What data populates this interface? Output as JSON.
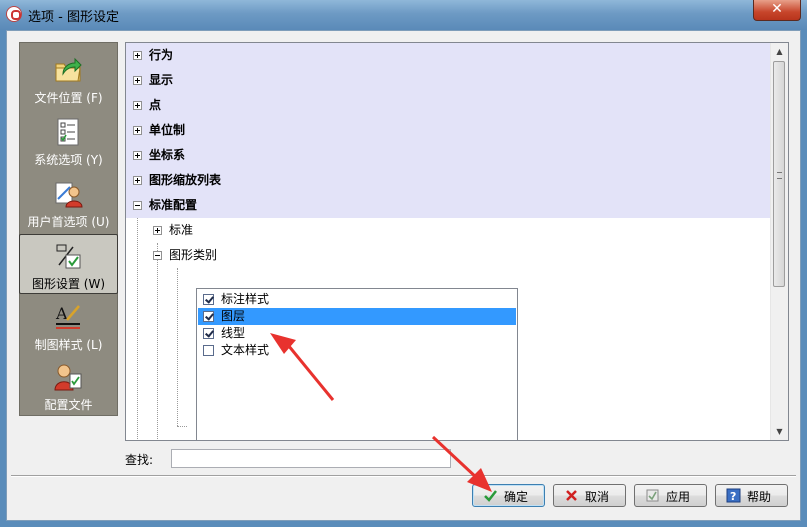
{
  "window": {
    "title": "选项 - 图形设定",
    "close_label": "✕"
  },
  "sidebar": {
    "items": [
      {
        "label": "文件位置 (F)",
        "icon": "folder-arrow-icon",
        "selected": false
      },
      {
        "label": "系统选项 (Y)",
        "icon": "checklist-icon",
        "selected": false
      },
      {
        "label": "用户首选项 (U)",
        "icon": "user-preferences-icon",
        "selected": false
      },
      {
        "label": "图形设置 (W)",
        "icon": "graphic-settings-icon",
        "selected": true
      },
      {
        "label": "制图样式 (L)",
        "icon": "drafting-style-icon",
        "selected": false
      },
      {
        "label": "配置文件",
        "icon": "profile-icon",
        "selected": false
      }
    ]
  },
  "tree": {
    "items": [
      {
        "label": "行为",
        "expanded": false
      },
      {
        "label": "显示",
        "expanded": false
      },
      {
        "label": "点",
        "expanded": false
      },
      {
        "label": "单位制",
        "expanded": false
      },
      {
        "label": "坐标系",
        "expanded": false
      },
      {
        "label": "图形缩放列表",
        "expanded": false
      },
      {
        "label": "标准配置",
        "expanded": true
      }
    ],
    "children": [
      {
        "label": "标准",
        "expanded": false
      },
      {
        "label": "图形类别",
        "expanded": true
      }
    ],
    "category_list": [
      {
        "label": "标注样式",
        "checked": true,
        "selected": false
      },
      {
        "label": "图层",
        "checked": true,
        "selected": true
      },
      {
        "label": "线型",
        "checked": true,
        "selected": false
      },
      {
        "label": "文本样式",
        "checked": false,
        "selected": false
      }
    ]
  },
  "search": {
    "label": "查找:",
    "value": ""
  },
  "buttons": {
    "ok": "确定",
    "cancel": "取消",
    "apply": "应用",
    "help": "帮助"
  },
  "colors": {
    "highlight_row": "#e3e3f8",
    "selection": "#3399ff",
    "annotation_arrow": "#e8322e"
  }
}
